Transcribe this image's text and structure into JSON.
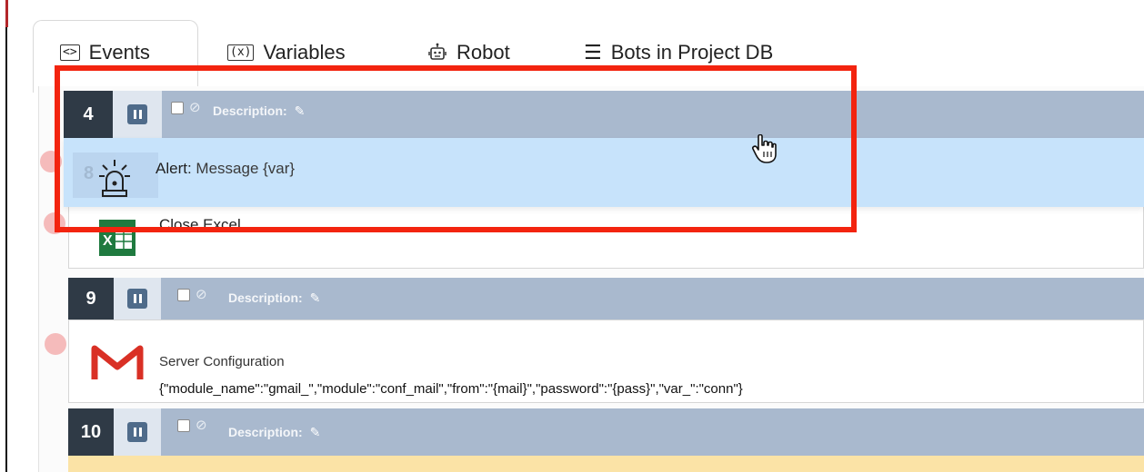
{
  "tabs": [
    {
      "label": "Events",
      "icon": "code-brackets-icon",
      "active": true
    },
    {
      "label": "Variables",
      "icon": "variable-x-icon",
      "active": false
    },
    {
      "label": "Robot",
      "icon": "robot-icon",
      "active": false
    },
    {
      "label": "Bots in Project DB",
      "icon": "list-icon",
      "active": false
    }
  ],
  "dragged_row": {
    "number": "4",
    "description_label": "Description:",
    "command_label": "Alert:",
    "command_value": "Message {var}",
    "hidden_number": "8"
  },
  "rows": [
    {
      "number": "9",
      "description_label": "Description:",
      "icon": "gmail-icon",
      "title": "Server Configuration",
      "params": "{\"module_name\":\"gmail_\",\"module\":\"conf_mail\",\"from\":\"{mail}\",\"password\":\"{pass}\",\"var_\":\"conn\"}"
    },
    {
      "number": "10",
      "description_label": "Description:"
    }
  ],
  "excel_row": {
    "label": "Close Excel",
    "icon": "excel-icon"
  },
  "colors": {
    "row_header": "#a9b9ce",
    "number_box": "#2f3a46",
    "drag_body": "#c7e3fb",
    "highlight_box": "#f3240f",
    "warning_row": "#fbe3a6"
  }
}
